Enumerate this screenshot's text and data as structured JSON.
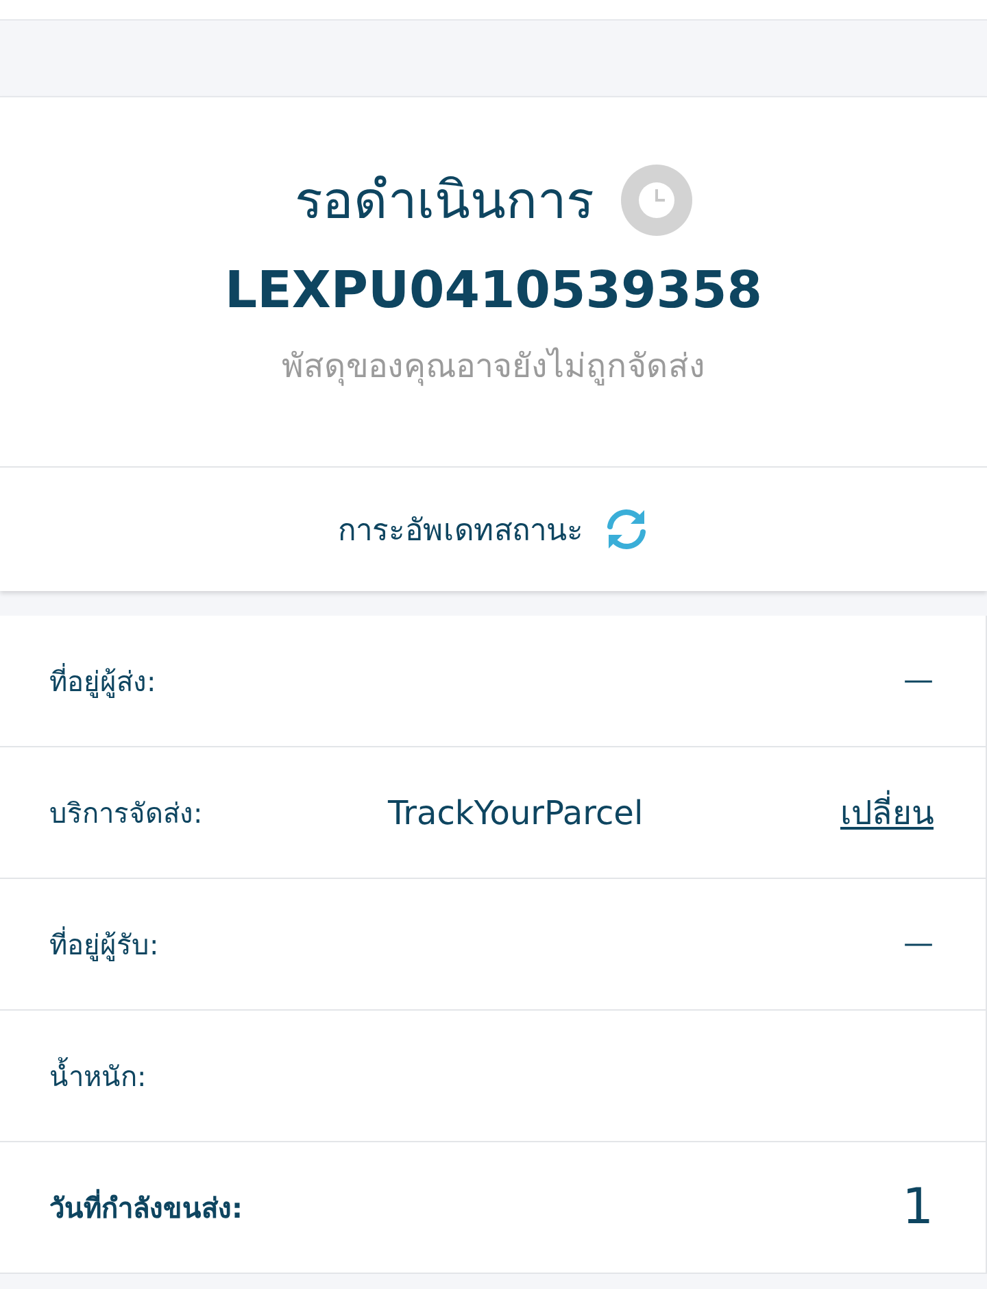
{
  "status": {
    "title": "รอดำเนินการ",
    "tracking_number": "LEXPU0410539358",
    "message": "พัสดุของคุณอาจยังไม่ถูกจัดส่ง"
  },
  "update": {
    "label": "การะอัพเดทสถานะ"
  },
  "details": [
    {
      "kind": "plain",
      "label": "ที่อยู่ผู้ส่ง:",
      "value": "—"
    },
    {
      "kind": "service",
      "label": "บริการจัดส่ง:",
      "value": "TrackYourParcel",
      "action": "เปลี่ยน"
    },
    {
      "kind": "plain",
      "label": "ที่อยู่ผู้รับ:",
      "value": "—"
    },
    {
      "kind": "plain",
      "label": "น้ำหนัก:"
    },
    {
      "kind": "emphasis",
      "label": "วันที่กำลังขนส่ง:",
      "value": "1"
    }
  ]
}
